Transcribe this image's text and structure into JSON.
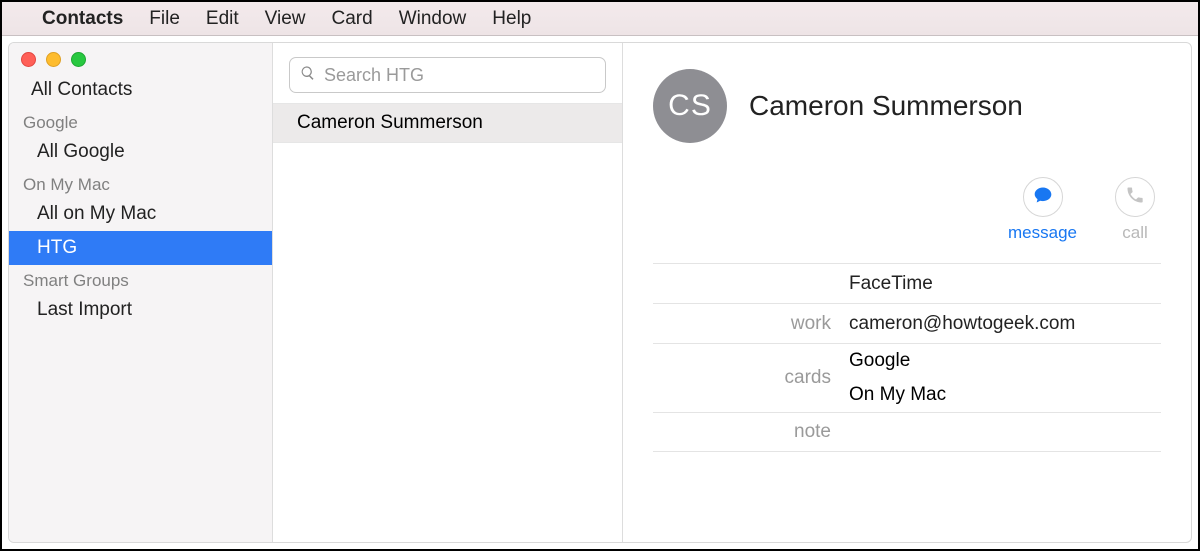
{
  "menubar": {
    "app": "Contacts",
    "items": [
      "File",
      "Edit",
      "View",
      "Card",
      "Window",
      "Help"
    ]
  },
  "sidebar": {
    "all": "All Contacts",
    "groups": [
      {
        "title": "Google",
        "items": [
          "All Google"
        ]
      },
      {
        "title": "On My Mac",
        "items": [
          "All on My Mac",
          "HTG"
        ],
        "selectedIndex": 1
      },
      {
        "title": "Smart Groups",
        "items": [
          "Last Import"
        ]
      }
    ]
  },
  "search": {
    "placeholder": "Search HTG"
  },
  "list": {
    "items": [
      "Cameron Summerson"
    ]
  },
  "contact": {
    "initials": "CS",
    "name": "Cameron Summerson",
    "actions": {
      "message": "message",
      "call": "call"
    },
    "fields": {
      "facetime_label": "",
      "facetime_value": "FaceTime",
      "work_label": "work",
      "work_value": "cameron@howtogeek.com",
      "cards_label": "cards",
      "cards_values": [
        "Google",
        "On My Mac"
      ],
      "note_label": "note",
      "note_value": ""
    }
  }
}
